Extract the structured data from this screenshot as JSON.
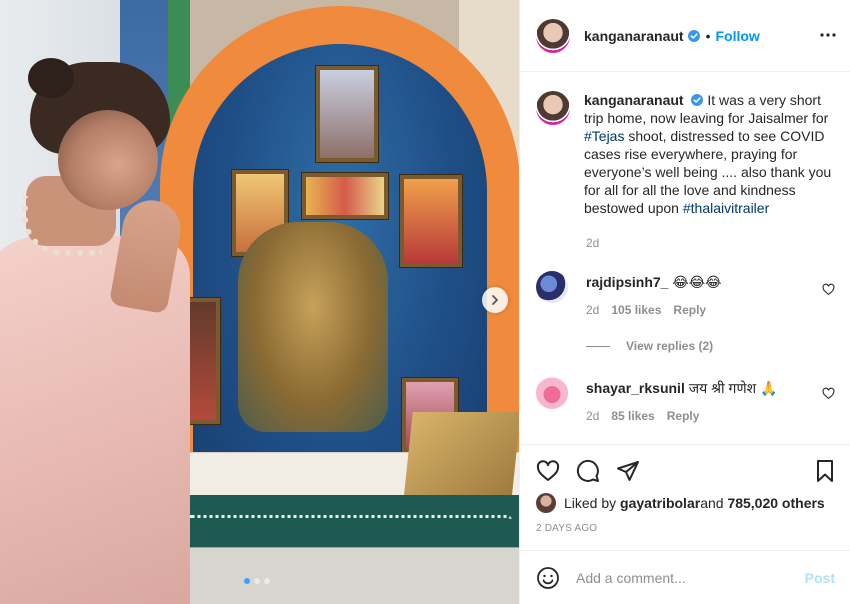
{
  "header": {
    "username": "kanganaranaut",
    "bullet": "•",
    "follow_label": "Follow"
  },
  "caption": {
    "username": "kanganaranaut",
    "text_1": "It was a very short trip home, now leaving for Jaisalmer for ",
    "hashtag_1": "#Tejas",
    "text_2": " shoot, distressed to see COVID cases rise everywhere, praying for everyone’s well being .... also thank you for all for all the love and kindness bestowed upon ",
    "hashtag_2": "#thalaivitrailer",
    "time": "2d"
  },
  "comments": [
    {
      "username": "rajdipsinh7_",
      "text": "😂😂😂",
      "time": "2d",
      "likes": "105 likes",
      "reply_label": "Reply"
    },
    {
      "username": "shayar_rksunil",
      "text": "जय श्री गणेश 🙏",
      "time": "2d",
      "likes": "85 likes",
      "reply_label": "Reply"
    }
  ],
  "view_replies": "View replies (2)",
  "likes": {
    "prefix": "Liked by ",
    "user": "gayatribolar",
    "suffix": " and ",
    "others": "785,020 others"
  },
  "post_date": "2 DAYS AGO",
  "add_comment": {
    "placeholder": "Add a comment...",
    "post_label": "Post"
  },
  "carousel": {
    "slide_count": 3,
    "active_index": 0
  },
  "icons": {
    "verified": "verified-badge-icon",
    "more": "more-options-icon",
    "heart": "heart-icon",
    "comment": "comment-icon",
    "share": "paper-plane-icon",
    "bookmark": "bookmark-icon",
    "emoji": "emoji-icon",
    "next": "chevron-right-icon"
  },
  "colors": {
    "link_blue": "#0095f6",
    "hashtag": "#00376b",
    "muted": "#8e8e8e",
    "post_disabled": "#b2dffc"
  }
}
